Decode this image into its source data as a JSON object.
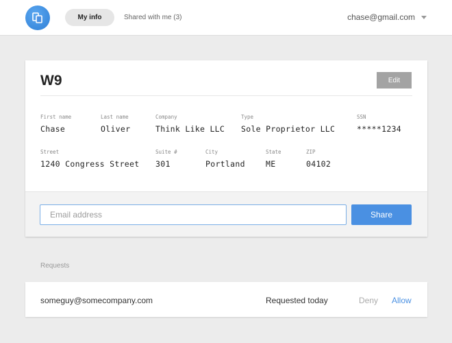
{
  "header": {
    "logo_icon": "documents-icon",
    "tabs": [
      {
        "label": "My info",
        "active": true
      },
      {
        "label": "Shared with me (3)",
        "active": false
      }
    ],
    "account": "chase@gmail.com"
  },
  "form": {
    "title": "W9",
    "edit_label": "Edit",
    "row1": [
      {
        "label": "First name",
        "value": "Chase"
      },
      {
        "label": "Last name",
        "value": "Oliver"
      },
      {
        "label": "Company",
        "value": "Think Like LLC"
      },
      {
        "label": "Type",
        "value": "Sole Proprietor LLC"
      },
      {
        "label": "SSN",
        "value": "*****1234"
      }
    ],
    "row2": [
      {
        "label": "Street",
        "value": "1240 Congress Street"
      },
      {
        "label": "Suite #",
        "value": "301"
      },
      {
        "label": "City",
        "value": "Portland"
      },
      {
        "label": "State",
        "value": "ME"
      },
      {
        "label": "ZIP",
        "value": "04102"
      }
    ]
  },
  "share": {
    "placeholder": "Email address",
    "value": "",
    "button_label": "Share"
  },
  "requests": {
    "heading": "Requests",
    "items": [
      {
        "email": "someguy@somecompany.com",
        "status": "Requested today",
        "deny_label": "Deny",
        "allow_label": "Allow"
      }
    ]
  },
  "colors": {
    "accent": "#4a90e2",
    "background": "#ececec",
    "edit_button": "#a3a3a3"
  }
}
